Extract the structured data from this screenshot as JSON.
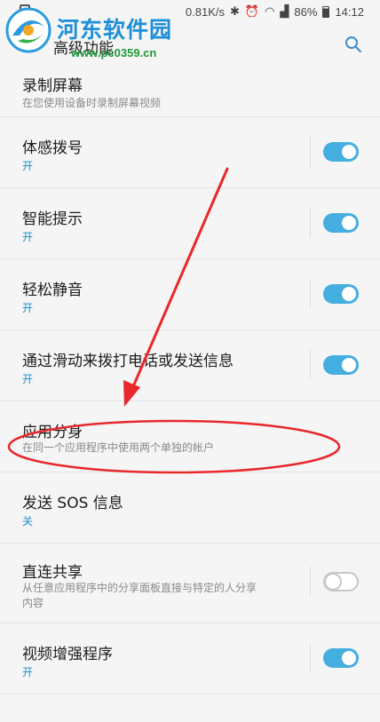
{
  "status_bar": {
    "network_speed": "0.81K/s",
    "battery": "86%",
    "time": "14:12"
  },
  "watermark": {
    "title": "河东软件园",
    "url": "www.pc0359.cn"
  },
  "header": {
    "title": "高级功能",
    "search_icon": "search-icon"
  },
  "settings": [
    {
      "label": "录制屏幕",
      "desc": "在您使用设备时录制屏幕视频",
      "has_toggle": false
    },
    {
      "label": "体感拨号",
      "state": "开",
      "toggle": true
    },
    {
      "label": "智能提示",
      "state": "开",
      "toggle": true
    },
    {
      "label": "轻松静音",
      "state": "开",
      "toggle": true
    },
    {
      "label": "通过滑动来拨打电话或发送信息",
      "state": "开",
      "toggle": true
    },
    {
      "label": "应用分身",
      "desc": "在同一个应用程序中使用两个单独的帐户",
      "has_toggle": false
    },
    {
      "label": "发送 SOS 信息",
      "state": "关",
      "has_toggle": false
    },
    {
      "label": "直连共享",
      "desc": "从任意应用程序中的分享面板直接与特定的人分享内容",
      "toggle": false
    },
    {
      "label": "视频增强程序",
      "state": "开",
      "toggle": true
    }
  ],
  "colors": {
    "accent": "#44aee0",
    "state_text": "#1a8fd0",
    "annotation": "#e8282b"
  }
}
